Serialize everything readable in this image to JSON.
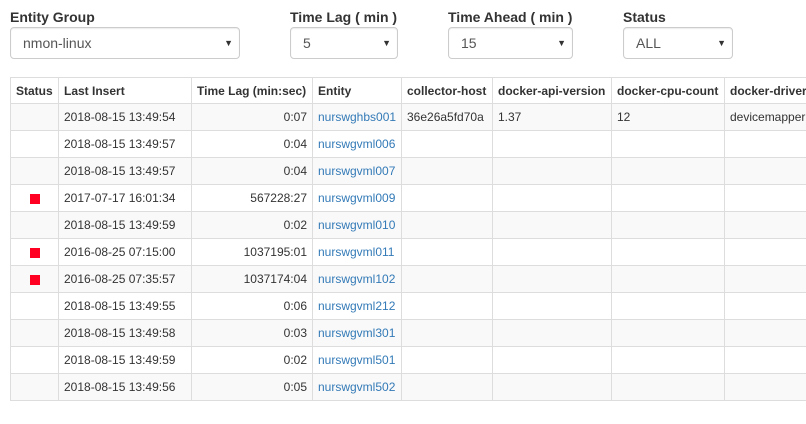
{
  "filters": {
    "entity_group": {
      "label": "Entity Group",
      "value": "nmon-linux"
    },
    "time_lag": {
      "label": "Time Lag ( min )",
      "value": "5"
    },
    "time_ahead": {
      "label": "Time Ahead ( min )",
      "value": "15"
    },
    "status": {
      "label": "Status",
      "value": "ALL"
    }
  },
  "table": {
    "columns": [
      "Status",
      "Last Insert",
      "Time Lag (min:sec)",
      "Entity",
      "collector-host",
      "docker-api-version",
      "docker-cpu-count",
      "docker-driver"
    ],
    "rows": [
      {
        "alert": false,
        "last_insert": "2018-08-15 13:49:54",
        "time_lag": "0:07",
        "entity": "nurswghbs001",
        "collector_host": "36e26a5fd70a",
        "docker_api_version": "1.37",
        "docker_cpu_count": "12",
        "docker_driver": "devicemapper"
      },
      {
        "alert": false,
        "last_insert": "2018-08-15 13:49:57",
        "time_lag": "0:04",
        "entity": "nurswgvml006",
        "collector_host": "",
        "docker_api_version": "",
        "docker_cpu_count": "",
        "docker_driver": ""
      },
      {
        "alert": false,
        "last_insert": "2018-08-15 13:49:57",
        "time_lag": "0:04",
        "entity": "nurswgvml007",
        "collector_host": "",
        "docker_api_version": "",
        "docker_cpu_count": "",
        "docker_driver": ""
      },
      {
        "alert": true,
        "last_insert": "2017-07-17 16:01:34",
        "time_lag": "567228:27",
        "entity": "nurswgvml009",
        "collector_host": "",
        "docker_api_version": "",
        "docker_cpu_count": "",
        "docker_driver": ""
      },
      {
        "alert": false,
        "last_insert": "2018-08-15 13:49:59",
        "time_lag": "0:02",
        "entity": "nurswgvml010",
        "collector_host": "",
        "docker_api_version": "",
        "docker_cpu_count": "",
        "docker_driver": ""
      },
      {
        "alert": true,
        "last_insert": "2016-08-25 07:15:00",
        "time_lag": "1037195:01",
        "entity": "nurswgvml011",
        "collector_host": "",
        "docker_api_version": "",
        "docker_cpu_count": "",
        "docker_driver": ""
      },
      {
        "alert": true,
        "last_insert": "2016-08-25 07:35:57",
        "time_lag": "1037174:04",
        "entity": "nurswgvml102",
        "collector_host": "",
        "docker_api_version": "",
        "docker_cpu_count": "",
        "docker_driver": ""
      },
      {
        "alert": false,
        "last_insert": "2018-08-15 13:49:55",
        "time_lag": "0:06",
        "entity": "nurswgvml212",
        "collector_host": "",
        "docker_api_version": "",
        "docker_cpu_count": "",
        "docker_driver": ""
      },
      {
        "alert": false,
        "last_insert": "2018-08-15 13:49:58",
        "time_lag": "0:03",
        "entity": "nurswgvml301",
        "collector_host": "",
        "docker_api_version": "",
        "docker_cpu_count": "",
        "docker_driver": ""
      },
      {
        "alert": false,
        "last_insert": "2018-08-15 13:49:59",
        "time_lag": "0:02",
        "entity": "nurswgvml501",
        "collector_host": "",
        "docker_api_version": "",
        "docker_cpu_count": "",
        "docker_driver": ""
      },
      {
        "alert": false,
        "last_insert": "2018-08-15 13:49:56",
        "time_lag": "0:05",
        "entity": "nurswgvml502",
        "collector_host": "",
        "docker_api_version": "",
        "docker_cpu_count": "",
        "docker_driver": ""
      }
    ]
  }
}
